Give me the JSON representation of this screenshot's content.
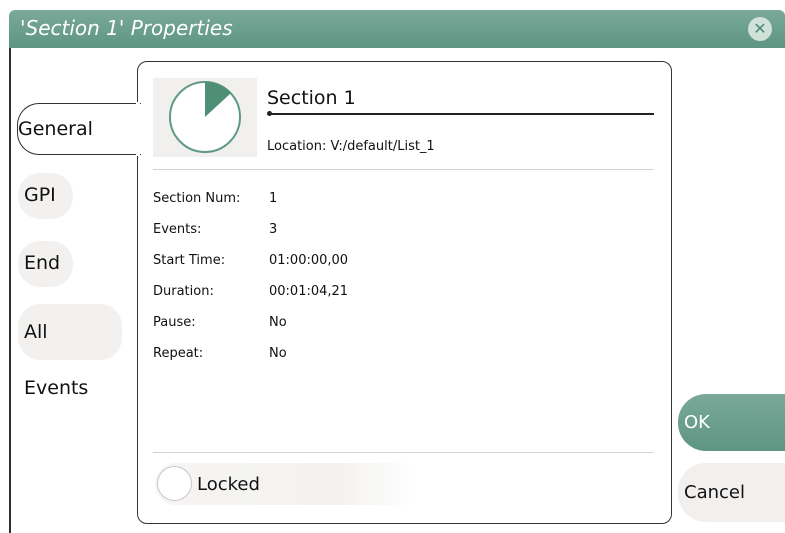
{
  "window": {
    "title": "'Section 1' Properties",
    "close_icon": "close-icon"
  },
  "tabs": [
    {
      "label": "General",
      "active": true
    },
    {
      "label": "GPI",
      "active": false
    },
    {
      "label": "End",
      "active": false
    },
    {
      "label": "All Events",
      "active": false
    }
  ],
  "general": {
    "icon": "pie-clock-icon",
    "name": "Section 1",
    "location": "Location: V:/default/List_1",
    "properties": [
      {
        "label": "Section Num:",
        "value": "1"
      },
      {
        "label": "Events:",
        "value": "3"
      },
      {
        "label": "Start Time:",
        "value": "01:00:00,00"
      },
      {
        "label": "Duration:",
        "value": "00:01:04,21"
      },
      {
        "label": "Pause:",
        "value": "No"
      },
      {
        "label": "Repeat:",
        "value": "No"
      }
    ],
    "locked_label": "Locked",
    "locked_on": false
  },
  "buttons": {
    "ok": "OK",
    "cancel": "Cancel"
  },
  "colors": {
    "accent": "#6a9f8d",
    "title_text": "#ffffff",
    "tab_bg": "#f3f1ef"
  }
}
